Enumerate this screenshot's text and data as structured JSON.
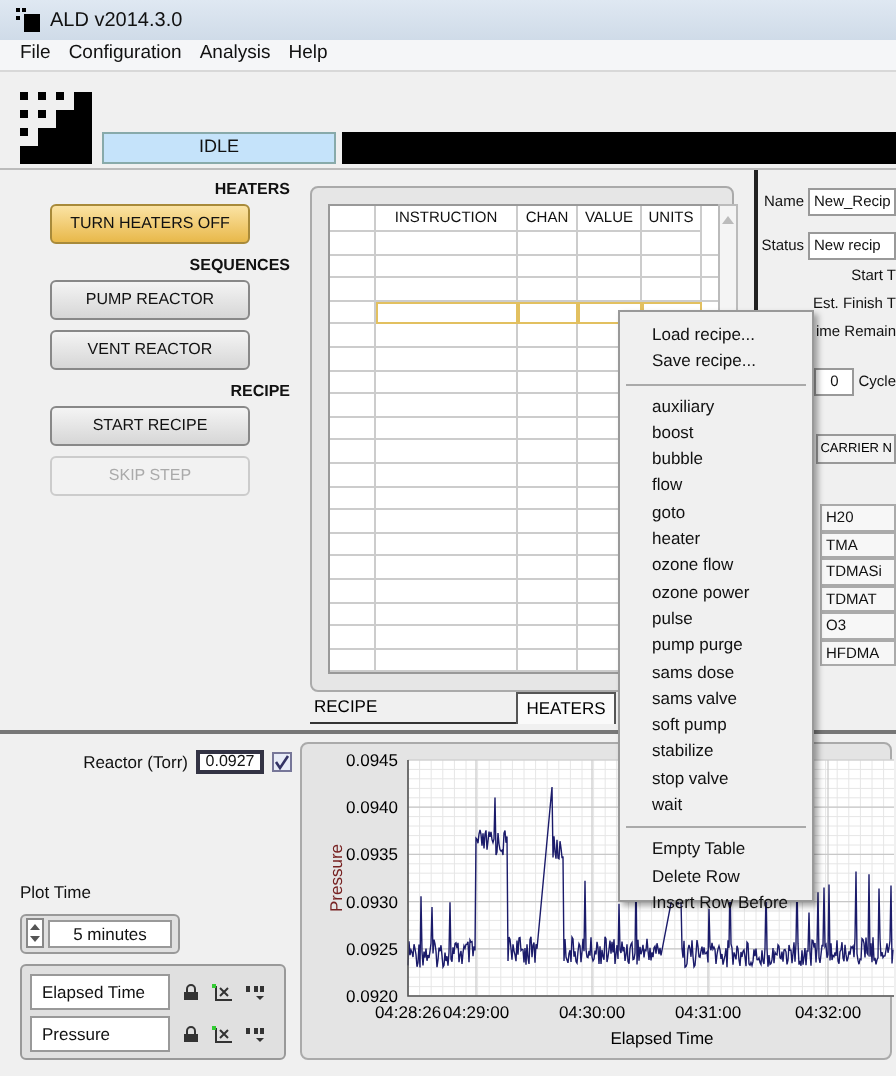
{
  "window": {
    "title": "ALD v2014.3.0"
  },
  "menu": [
    "File",
    "Configuration",
    "Analysis",
    "Help"
  ],
  "status": {
    "text": "IDLE"
  },
  "sections": [
    {
      "heading": "HEATERS",
      "buttons": [
        {
          "label": "TURN HEATERS OFF",
          "active": true,
          "disabled": false
        }
      ]
    },
    {
      "heading": "SEQUENCES",
      "buttons": [
        {
          "label": "PUMP REACTOR",
          "active": false,
          "disabled": false
        },
        {
          "label": "VENT REACTOR",
          "active": false,
          "disabled": false
        }
      ]
    },
    {
      "heading": "RECIPE",
      "buttons": [
        {
          "label": "START RECIPE",
          "active": false,
          "disabled": false
        },
        {
          "label": "SKIP STEP",
          "active": false,
          "disabled": true
        }
      ]
    }
  ],
  "recipe_table": {
    "columns": [
      "INSTRUCTION",
      "CHAN",
      "VALUE",
      "UNITS"
    ],
    "rows": [
      {
        "selected": false
      },
      {
        "selected": false
      },
      {
        "selected": false
      },
      {
        "selected": true
      },
      {
        "selected": false
      },
      {
        "selected": false
      },
      {
        "selected": false
      },
      {
        "selected": false
      },
      {
        "selected": false
      },
      {
        "selected": false
      },
      {
        "selected": false
      },
      {
        "selected": false
      },
      {
        "selected": false
      },
      {
        "selected": false
      },
      {
        "selected": false
      },
      {
        "selected": false
      },
      {
        "selected": false
      },
      {
        "selected": false
      },
      {
        "selected": false
      }
    ]
  },
  "tabs": [
    {
      "label": "RECIPE",
      "selected": true
    },
    {
      "label": "HEATERS",
      "selected": false
    }
  ],
  "context_menu": {
    "groups": [
      [
        "Load recipe...",
        "Save recipe..."
      ],
      [
        "auxiliary",
        "boost",
        "bubble",
        "flow",
        "goto",
        "heater",
        "ozone flow",
        "ozone power",
        "pulse",
        "pump purge",
        "sams dose",
        "sams valve",
        "soft pump",
        "stabilize",
        "stop valve",
        "wait"
      ],
      [
        "Empty Table",
        "Delete Row",
        "Insert Row Before"
      ]
    ]
  },
  "recipe_info": {
    "name_label": "Name",
    "name_value": "New_Recip",
    "status_label": "Status",
    "status_value": "New recip",
    "start_label": "Start T",
    "finish_label": "Est. Finish T",
    "remaining_label": "ime Remain",
    "cycles_value": "0",
    "cycles_label": "Cycle",
    "carrier_button": "CARRIER N",
    "precursors": [
      "H20",
      "TMA",
      "TDMASi",
      "TDMAT",
      "O3",
      "HFDMA"
    ]
  },
  "reactor": {
    "label": "Reactor (Torr)",
    "value": "0.0927",
    "checked": true
  },
  "plot_time": {
    "label": "Plot Time",
    "value": "5 minutes"
  },
  "legend": [
    {
      "name": "Elapsed Time"
    },
    {
      "name": "Pressure"
    }
  ],
  "chart": {
    "ylabel": "Pressure",
    "xlabel": "Elapsed Time",
    "yticks": [
      "0.0945",
      "0.0940",
      "0.0935",
      "0.0930",
      "0.0925",
      "0.0920"
    ],
    "xticks": [
      "04:28:26",
      "04:29:00",
      "04:30:00",
      "04:31:00",
      "04:32:00"
    ]
  }
}
